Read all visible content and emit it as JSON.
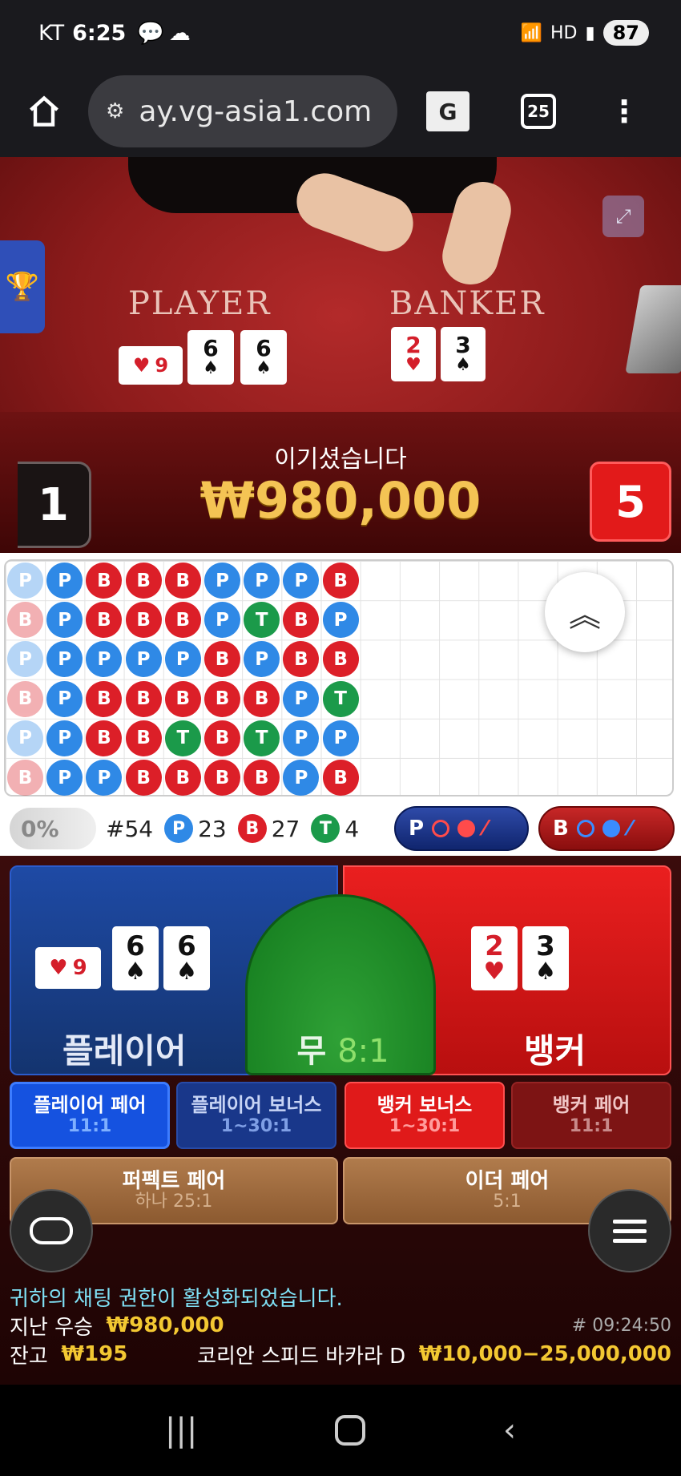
{
  "status_bar": {
    "carrier": "KT",
    "time": "6:25",
    "battery": "87"
  },
  "browser": {
    "url": "ay.vg-asia1.com",
    "tab_count": "25"
  },
  "table": {
    "player_label": "PLAYER",
    "banker_label": "BANKER",
    "win_message": "이기셨습니다",
    "win_amount": "₩980,000",
    "player_score": "1",
    "banker_score": "5",
    "player_cards": [
      {
        "rank": "9",
        "suit": "♥",
        "color": "red"
      },
      {
        "rank": "6",
        "suit": "♠",
        "color": "black"
      },
      {
        "rank": "6",
        "suit": "♠",
        "color": "black"
      }
    ],
    "banker_cards": [
      {
        "rank": "2",
        "suit": "♥",
        "color": "red"
      },
      {
        "rank": "3",
        "suit": "♠",
        "color": "black"
      }
    ]
  },
  "roadmap": {
    "columns": [
      [
        "P",
        "B",
        "P",
        "B",
        "P",
        "B"
      ],
      [
        "P",
        "P",
        "P",
        "P",
        "P",
        "P"
      ],
      [
        "B",
        "B",
        "P",
        "B",
        "B",
        "P"
      ],
      [
        "B",
        "B",
        "P",
        "B",
        "B",
        "B"
      ],
      [
        "B",
        "B",
        "P",
        "B",
        "T",
        "B"
      ],
      [
        "P",
        "P",
        "B",
        "B",
        "B",
        "B"
      ],
      [
        "P",
        "T",
        "P",
        "B",
        "T",
        "B"
      ],
      [
        "P",
        "B",
        "B",
        "P",
        "P",
        "P"
      ],
      [
        "B",
        "P",
        "B",
        "T",
        "P",
        "B"
      ]
    ]
  },
  "stats": {
    "percent": "0%",
    "round": "#54",
    "player_count": "23",
    "banker_count": "27",
    "tie_count": "4",
    "p_letter": "P",
    "b_letter": "B",
    "t_letter": "T"
  },
  "bets": {
    "player": "플레이어",
    "banker": "뱅커",
    "tie": "무",
    "tie_odds": "8:1",
    "player_pair": "플레이어 페어",
    "player_pair_odds": "11:1",
    "player_bonus": "플레이어 보너스",
    "player_bonus_odds": "1~30:1",
    "banker_bonus": "뱅커 보너스",
    "banker_bonus_odds": "1~30:1",
    "banker_pair": "뱅커 페어",
    "banker_pair_odds": "11:1",
    "perfect_pair": "퍼펙트 페어",
    "perfect_pair_odds": "하나 25:1",
    "either_pair": "이더 페어",
    "either_pair_odds": "5:1"
  },
  "info": {
    "chat_message": "귀하의 채팅 권한이 활성화되었습니다.",
    "last_win_label": "지난 우승",
    "last_win_amount": "₩980,000",
    "game_id": "# 09:24:50",
    "balance_label": "잔고",
    "balance": "₩195",
    "table_name": "코리안 스피드 바카라 D",
    "limits": "₩10,000−25,000,000"
  },
  "colors": {
    "player": "#2f89e6",
    "banker": "#dc1f28",
    "tie": "#1b9a4a",
    "gold": "#f3c832"
  }
}
